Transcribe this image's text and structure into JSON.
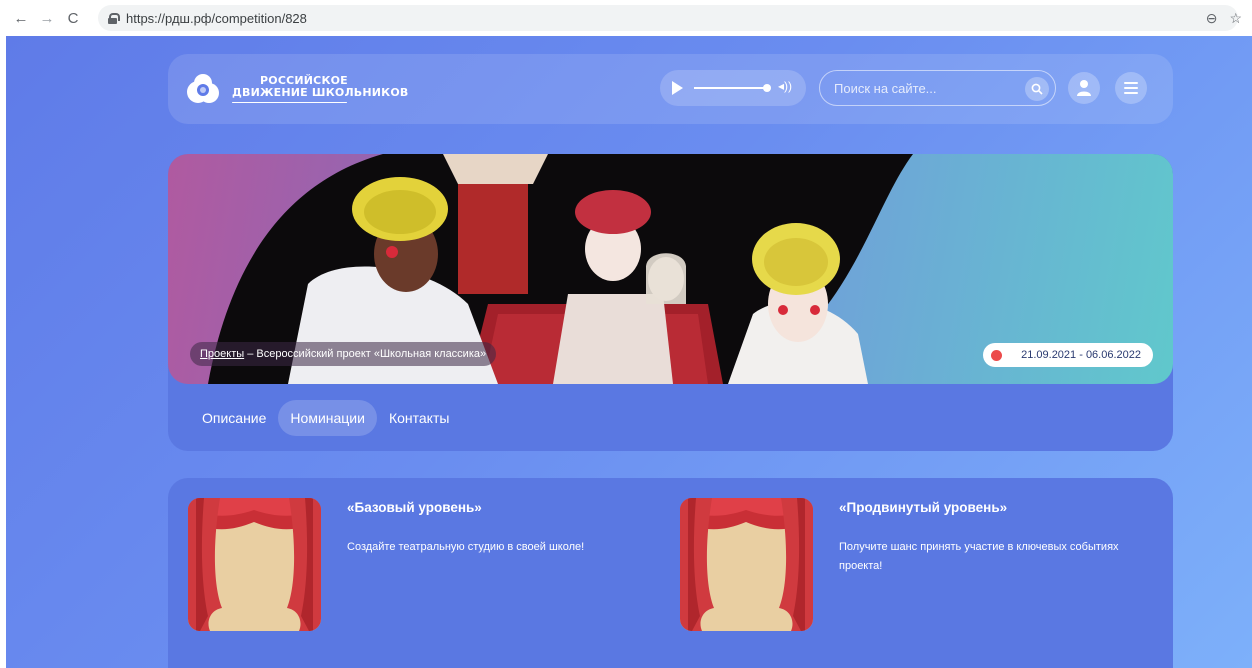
{
  "browser": {
    "url": "https://рдш.рф/competition/828",
    "back_glyph": "←",
    "forward_glyph": "→",
    "reload_glyph": "C",
    "zoom_glyph": "⊖",
    "star_glyph": "☆"
  },
  "header": {
    "logo_line1": "РОССИЙСКОЕ",
    "logo_line2": "ДВИЖЕНИЕ ШКОЛЬНИКОВ",
    "search_placeholder": "Поиск на сайте...",
    "volume_glyph": "◂))"
  },
  "hero": {
    "breadcrumb_link": "Проекты",
    "breadcrumb_rest": " – Всероссийский проект «Школьная классика»",
    "dates": "21.09.2021 - 06.06.2022"
  },
  "tabs": [
    {
      "label": "Описание",
      "active": false
    },
    {
      "label": "Номинации",
      "active": true
    },
    {
      "label": "Контакты",
      "active": false
    }
  ],
  "nominations": [
    {
      "title": "«Базовый уровень»",
      "description": "Создайте театральную студию в своей школе!"
    },
    {
      "title": "«Продвинутый уровень»",
      "description": "Получите шанс принять участие в ключевых событиях проекта!"
    }
  ],
  "colors": {
    "page_gradient_start": "#5f7be8",
    "page_gradient_end": "#7db0fa",
    "card": "#5a78e2",
    "date_dot": "#ec4b4b",
    "curtain_red": "#d03a3f",
    "curtain_bg": "#e9cfa2"
  }
}
